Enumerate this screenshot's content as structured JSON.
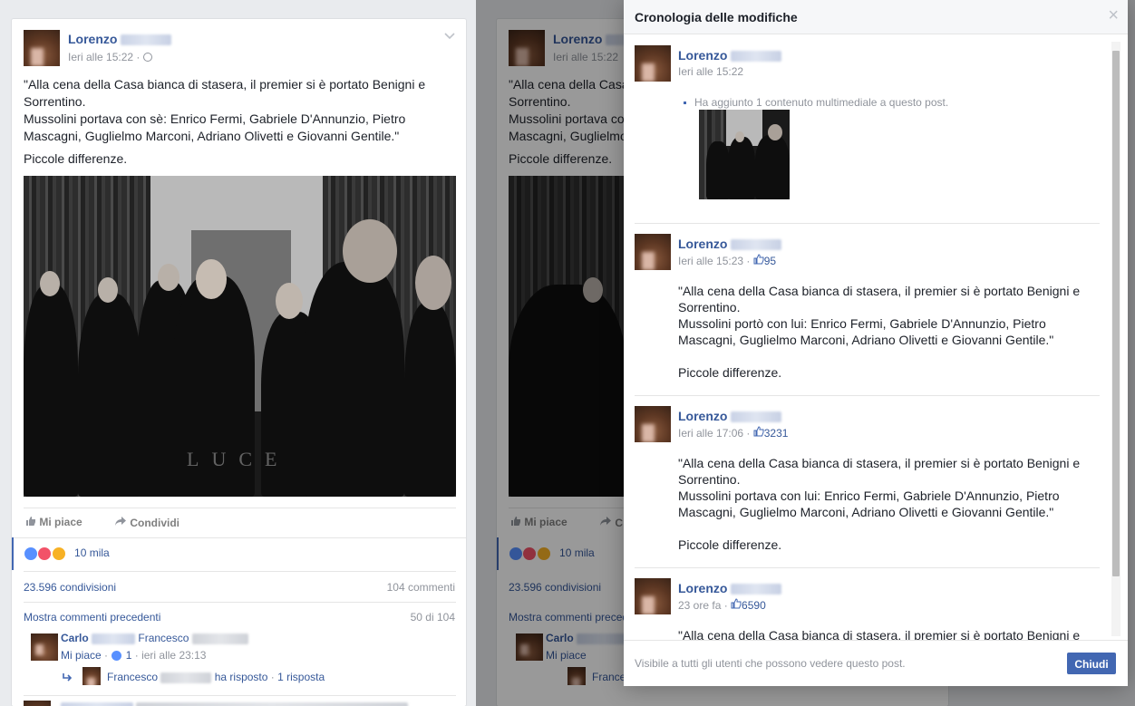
{
  "post": {
    "author_first": "Lorenzo",
    "time": "Ieri alle 15:22",
    "text_lines": [
      "\"Alla cena della Casa bianca di stasera, il premier si è portato Benigni e",
      "Sorrentino.",
      "Mussolini portava con sè: Enrico Fermi, Gabriele D'Annunzio, Pietro",
      "Mascagni, Guglielmo Marconi, Adriano Olivetti e Giovanni Gentile.\""
    ],
    "text_last": "Piccole differenze.",
    "photo_watermark": "LUCE",
    "like_label": "Mi piace",
    "share_label": "Condividi",
    "reactions_count": "10 mila",
    "shares": "23.596 condivisioni",
    "comments_count": "104 commenti",
    "prev_comments": "Mostra commenti precedenti",
    "comments_range": "50 di 104",
    "comment": {
      "author": "Carlo",
      "tagged": "Francesco",
      "like_label": "Mi piace",
      "like_count": "1",
      "time": "ieri alle 23:13",
      "reply_author": "Francesco",
      "reply_action": "ha risposto",
      "reply_count": "1 risposta"
    }
  },
  "background_post": {
    "author_first": "Lorenzo",
    "time": "Ieri alle 15:22",
    "text_lines": [
      "\"Alla cena della Casa bianca di stasera, il premier si è portato Benigni e",
      "Sorrentino.",
      "Mussolini portava con sè: Enrico Fermi, Gabriele D'Annunzio, Pietro",
      "Mascagni, Guglielmo Marconi, Adriano Olivetti e Giovanni Gentile.\""
    ],
    "text_last": "Piccole differenze.",
    "like_label": "Mi piace",
    "share_partial": "C",
    "reactions_count": "10 mila",
    "shares": "23.596 condivisioni",
    "prev_comments": "Mostra commenti precedenti",
    "comment_author": "Carlo",
    "comment_like_label": "Mi piace",
    "reply_author_partial": "France"
  },
  "modal": {
    "title": "Cronologia delle modifiche",
    "close_glyph": "×",
    "footer_text": "Visibile a tutti gli utenti che possono vedere questo post.",
    "close_button": "Chiudi",
    "entries": [
      {
        "author": "Lorenzo",
        "time": "Ieri alle 15:22",
        "change": "Ha aggiunto 1 contenuto multimediale a questo post."
      },
      {
        "author": "Lorenzo",
        "time": "Ieri alle 15:23",
        "likes": "95",
        "text": "\"Alla cena della Casa bianca di stasera, il premier si è portato Benigni e\nSorrentino.\nMussolini portò con lui: Enrico Fermi, Gabriele D'Annunzio, Pietro\nMascagni, Guglielmo Marconi, Adriano Olivetti e Giovanni Gentile.\"\n\nPiccole differenze."
      },
      {
        "author": "Lorenzo",
        "time": "Ieri alle 17:06",
        "likes": "3231",
        "text": "\"Alla cena della Casa bianca di stasera, il premier si è portato Benigni e\nSorrentino.\nMussolini portava con lui: Enrico Fermi, Gabriele D'Annunzio, Pietro\nMascagni, Guglielmo Marconi, Adriano Olivetti e Giovanni Gentile.\"\n\nPiccole differenze."
      },
      {
        "author": "Lorenzo",
        "time": "23 ore fa",
        "likes": "6590",
        "text": "\"Alla cena della Casa bianca di stasera, il premier si è portato Benigni e"
      }
    ]
  },
  "colors": {
    "link_blue": "#365899",
    "button_blue": "#4267b2",
    "like_blue": "#5890ff",
    "love_red": "#f25268",
    "wow_yellow": "#f7b125"
  },
  "icons": {
    "like": "thumbs-up-icon",
    "share": "share-arrow-icon",
    "globe": "globe-icon",
    "chevron": "chevron-down-icon",
    "reply": "reply-arrow-icon"
  }
}
